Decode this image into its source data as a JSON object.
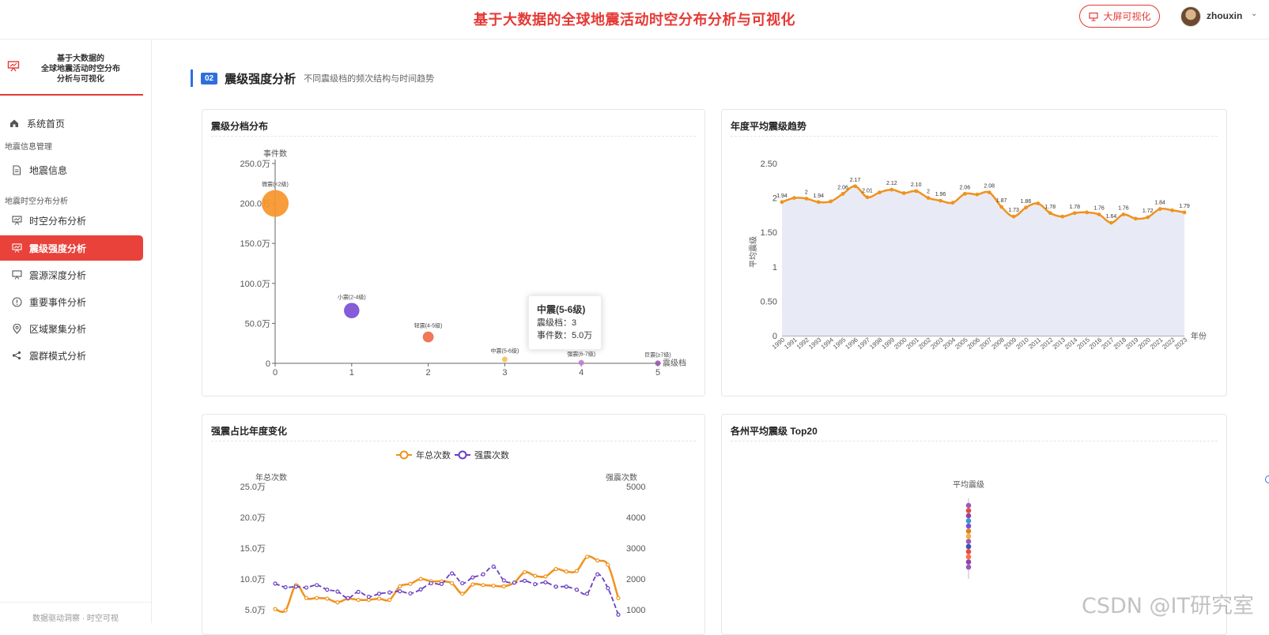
{
  "header": {
    "title": "基于大数据的全球地震活动时空分布分析与可视化",
    "bigscreen_label": "大屏可视化",
    "username": "zhouxin"
  },
  "sidebar": {
    "brand": "基于大数据的\n全球地震活动时空分布\n分析与可视化",
    "home": "系统首页",
    "group1": "地震信息管理",
    "item_info": "地震信息",
    "group2": "地震时空分布分析",
    "items": [
      "时空分布分析",
      "震级强度分析",
      "震源深度分析",
      "重要事件分析",
      "区域聚集分析",
      "震群模式分析"
    ],
    "footer": "数据驱动洞察 · 时空可视"
  },
  "section": {
    "number": "02",
    "title": "震级强度分析",
    "subtitle": "不同震级档的频次结构与时间趋势"
  },
  "cards": {
    "c1_title": "震级分档分布",
    "c2_title": "年度平均震级趋势",
    "c3_title": "强震占比年度变化",
    "c4_title": "各州平均震级 Top20"
  },
  "tooltip": {
    "title": "中震(5-6级)",
    "level_label": "震级档：",
    "level_value": "3",
    "count_label": "事件数：",
    "count_value": "5.0万"
  },
  "watermark": "CSDN @IT研究室",
  "chart_data": [
    {
      "type": "scatter",
      "title": "震级分档分布",
      "xlabel": "震级档",
      "ylabel": "事件数",
      "xlim": [
        0,
        5
      ],
      "ylim": [
        0,
        2500000
      ],
      "yticks": [
        "0",
        "50.0万",
        "100.0万",
        "150.0万",
        "200.0万",
        "250.0万"
      ],
      "xticks": [
        "0",
        "1",
        "2",
        "3",
        "4",
        "5"
      ],
      "points": [
        {
          "x": 0,
          "y": 2000000,
          "label": "微震(<2级)",
          "color": "#f7952a"
        },
        {
          "x": 1,
          "y": 660000,
          "label": "小震(2-4级)",
          "color": "#7b4fd6"
        },
        {
          "x": 2,
          "y": 330000,
          "label": "轻震(4-5级)",
          "color": "#ef6b4a"
        },
        {
          "x": 3,
          "y": 50000,
          "label": "中震(5-6级)",
          "color": "#f6c15a"
        },
        {
          "x": 4,
          "y": 8000,
          "label": "强震(6-7级)",
          "color": "#c27bd8"
        },
        {
          "x": 5,
          "y": 1000,
          "label": "巨震(≥7级)",
          "color": "#9b59b6"
        }
      ]
    },
    {
      "type": "area",
      "title": "年度平均震级趋势",
      "xlabel": "年份",
      "ylabel": "平均震级",
      "ylim": [
        0,
        2.5
      ],
      "yticks": [
        "0",
        "0.50",
        "1",
        "1.50",
        "2",
        "2.50"
      ],
      "x": [
        "1990",
        "1991",
        "1992",
        "1993",
        "1994",
        "1995",
        "1996",
        "1997",
        "1998",
        "1999",
        "2000",
        "2001",
        "2002",
        "2003",
        "2004",
        "2005",
        "2006",
        "2007",
        "2008",
        "2009",
        "2010",
        "2011",
        "2012",
        "2013",
        "2014",
        "2015",
        "2016",
        "2017",
        "2018",
        "2019",
        "2020",
        "2021",
        "2022",
        "2023"
      ],
      "values": [
        1.94,
        2.0,
        1.99,
        1.94,
        1.95,
        2.06,
        2.17,
        2.01,
        2.08,
        2.12,
        2.07,
        2.1,
        2.0,
        1.96,
        1.93,
        2.06,
        2.05,
        2.08,
        1.87,
        1.73,
        1.86,
        1.92,
        1.78,
        1.73,
        1.78,
        1.79,
        1.76,
        1.64,
        1.76,
        1.7,
        1.72,
        1.84,
        1.82,
        1.79
      ],
      "labels": [
        "1.94",
        "",
        "2",
        "1.94",
        "",
        "2.06",
        "2.17",
        "2.01",
        "",
        "2.12",
        "",
        "2.10",
        "2",
        "1.96",
        "",
        "2.06",
        "",
        "2.08",
        "1.87",
        "1.73",
        "1.86",
        "",
        "1.78",
        "",
        "1.78",
        "",
        "1.76",
        "1.64",
        "1.76",
        "",
        "1.72",
        "1.84",
        "",
        "1.79"
      ]
    },
    {
      "type": "line",
      "title": "强震占比年度变化",
      "legend": [
        "年总次数",
        "强震次数"
      ],
      "legend_position": "top-center",
      "y_left_label": "年总次数",
      "y_right_label": "强震次数",
      "y_left_ticks": [
        "5.0万",
        "10.0万",
        "15.0万",
        "20.0万",
        "25.0万"
      ],
      "y_right_ticks": [
        "1000",
        "2000",
        "3000",
        "4000",
        "5000"
      ],
      "y_left_lim": [
        0,
        250000
      ],
      "y_right_lim": [
        0,
        5000
      ],
      "series": [
        {
          "name": "年总次数",
          "color": "#f0921e",
          "values": [
            51000,
            49000,
            90000,
            69000,
            69000,
            68000,
            62000,
            68000,
            66000,
            66000,
            68000,
            66000,
            88000,
            92000,
            100000,
            96000,
            96000,
            93000,
            76000,
            91000,
            90000,
            89000,
            88000,
            94000,
            111000,
            105000,
            104000,
            116000,
            112000,
            113000,
            136000,
            130000,
            123000,
            69000
          ]
        },
        {
          "name": "强震次数",
          "color": "#6a3fc1",
          "values": [
            1850,
            1730,
            1750,
            1720,
            1800,
            1650,
            1590,
            1380,
            1580,
            1420,
            1520,
            1560,
            1600,
            1530,
            1660,
            1860,
            1840,
            2180,
            1860,
            2050,
            2150,
            2400,
            1950,
            1880,
            1940,
            1830,
            1890,
            1750,
            1750,
            1650,
            1520,
            2150,
            1700,
            840
          ]
        }
      ]
    },
    {
      "type": "scatter",
      "title": "各州平均震级 Top20",
      "ylabel": "平均震级",
      "colors": [
        "#9b59b6",
        "#e74c3c",
        "#8e44ad",
        "#3498db",
        "#7b4fd6",
        "#e67e22",
        "#f5b041",
        "#9b59b6",
        "#3f51b5",
        "#e74c3c",
        "#ff7043",
        "#8e44ad",
        "#9b59b6"
      ]
    }
  ]
}
